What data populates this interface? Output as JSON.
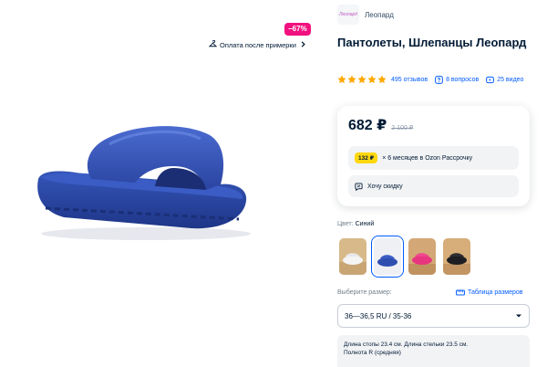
{
  "gallery": {
    "discount_badge": "−67%",
    "try_pay_label": "Оплата после примерки",
    "product_color": "#2f4fb0"
  },
  "brand": {
    "logo_text": "Леопард",
    "name": "Леопард"
  },
  "product": {
    "title": "Пантолеты, Шлепанцы Леопард"
  },
  "stats": {
    "rating_stars": 5,
    "reviews": "495 отзывов",
    "questions": "8 вопросов",
    "videos": "25 видео"
  },
  "price": {
    "current": "682 ₽",
    "old": "2 100 ₽",
    "installment_badge": "132 ₽",
    "installment_text": "× 6 месяцев в Ozon Рассрочку",
    "want_discount": "Хочу скидку"
  },
  "color": {
    "label": "Цвет:",
    "value": "Синий",
    "swatches": [
      {
        "name": "white",
        "selected": false
      },
      {
        "name": "blue",
        "selected": true
      },
      {
        "name": "pink",
        "selected": false
      },
      {
        "name": "black",
        "selected": false
      }
    ]
  },
  "size": {
    "label": "Выберите размер:",
    "table_link": "Таблица размеров",
    "selected": "36—36,5 RU / 35-36",
    "desc_line1": "Длина стопы 23.4 см. Длина стельки 23.5 см.",
    "desc_line2": "Полнота R (средняя)"
  },
  "colors": {
    "accent": "#005bff",
    "badge_pink": "#f1117e",
    "installment_yellow": "#ffd80f",
    "star": "#ffa800"
  }
}
